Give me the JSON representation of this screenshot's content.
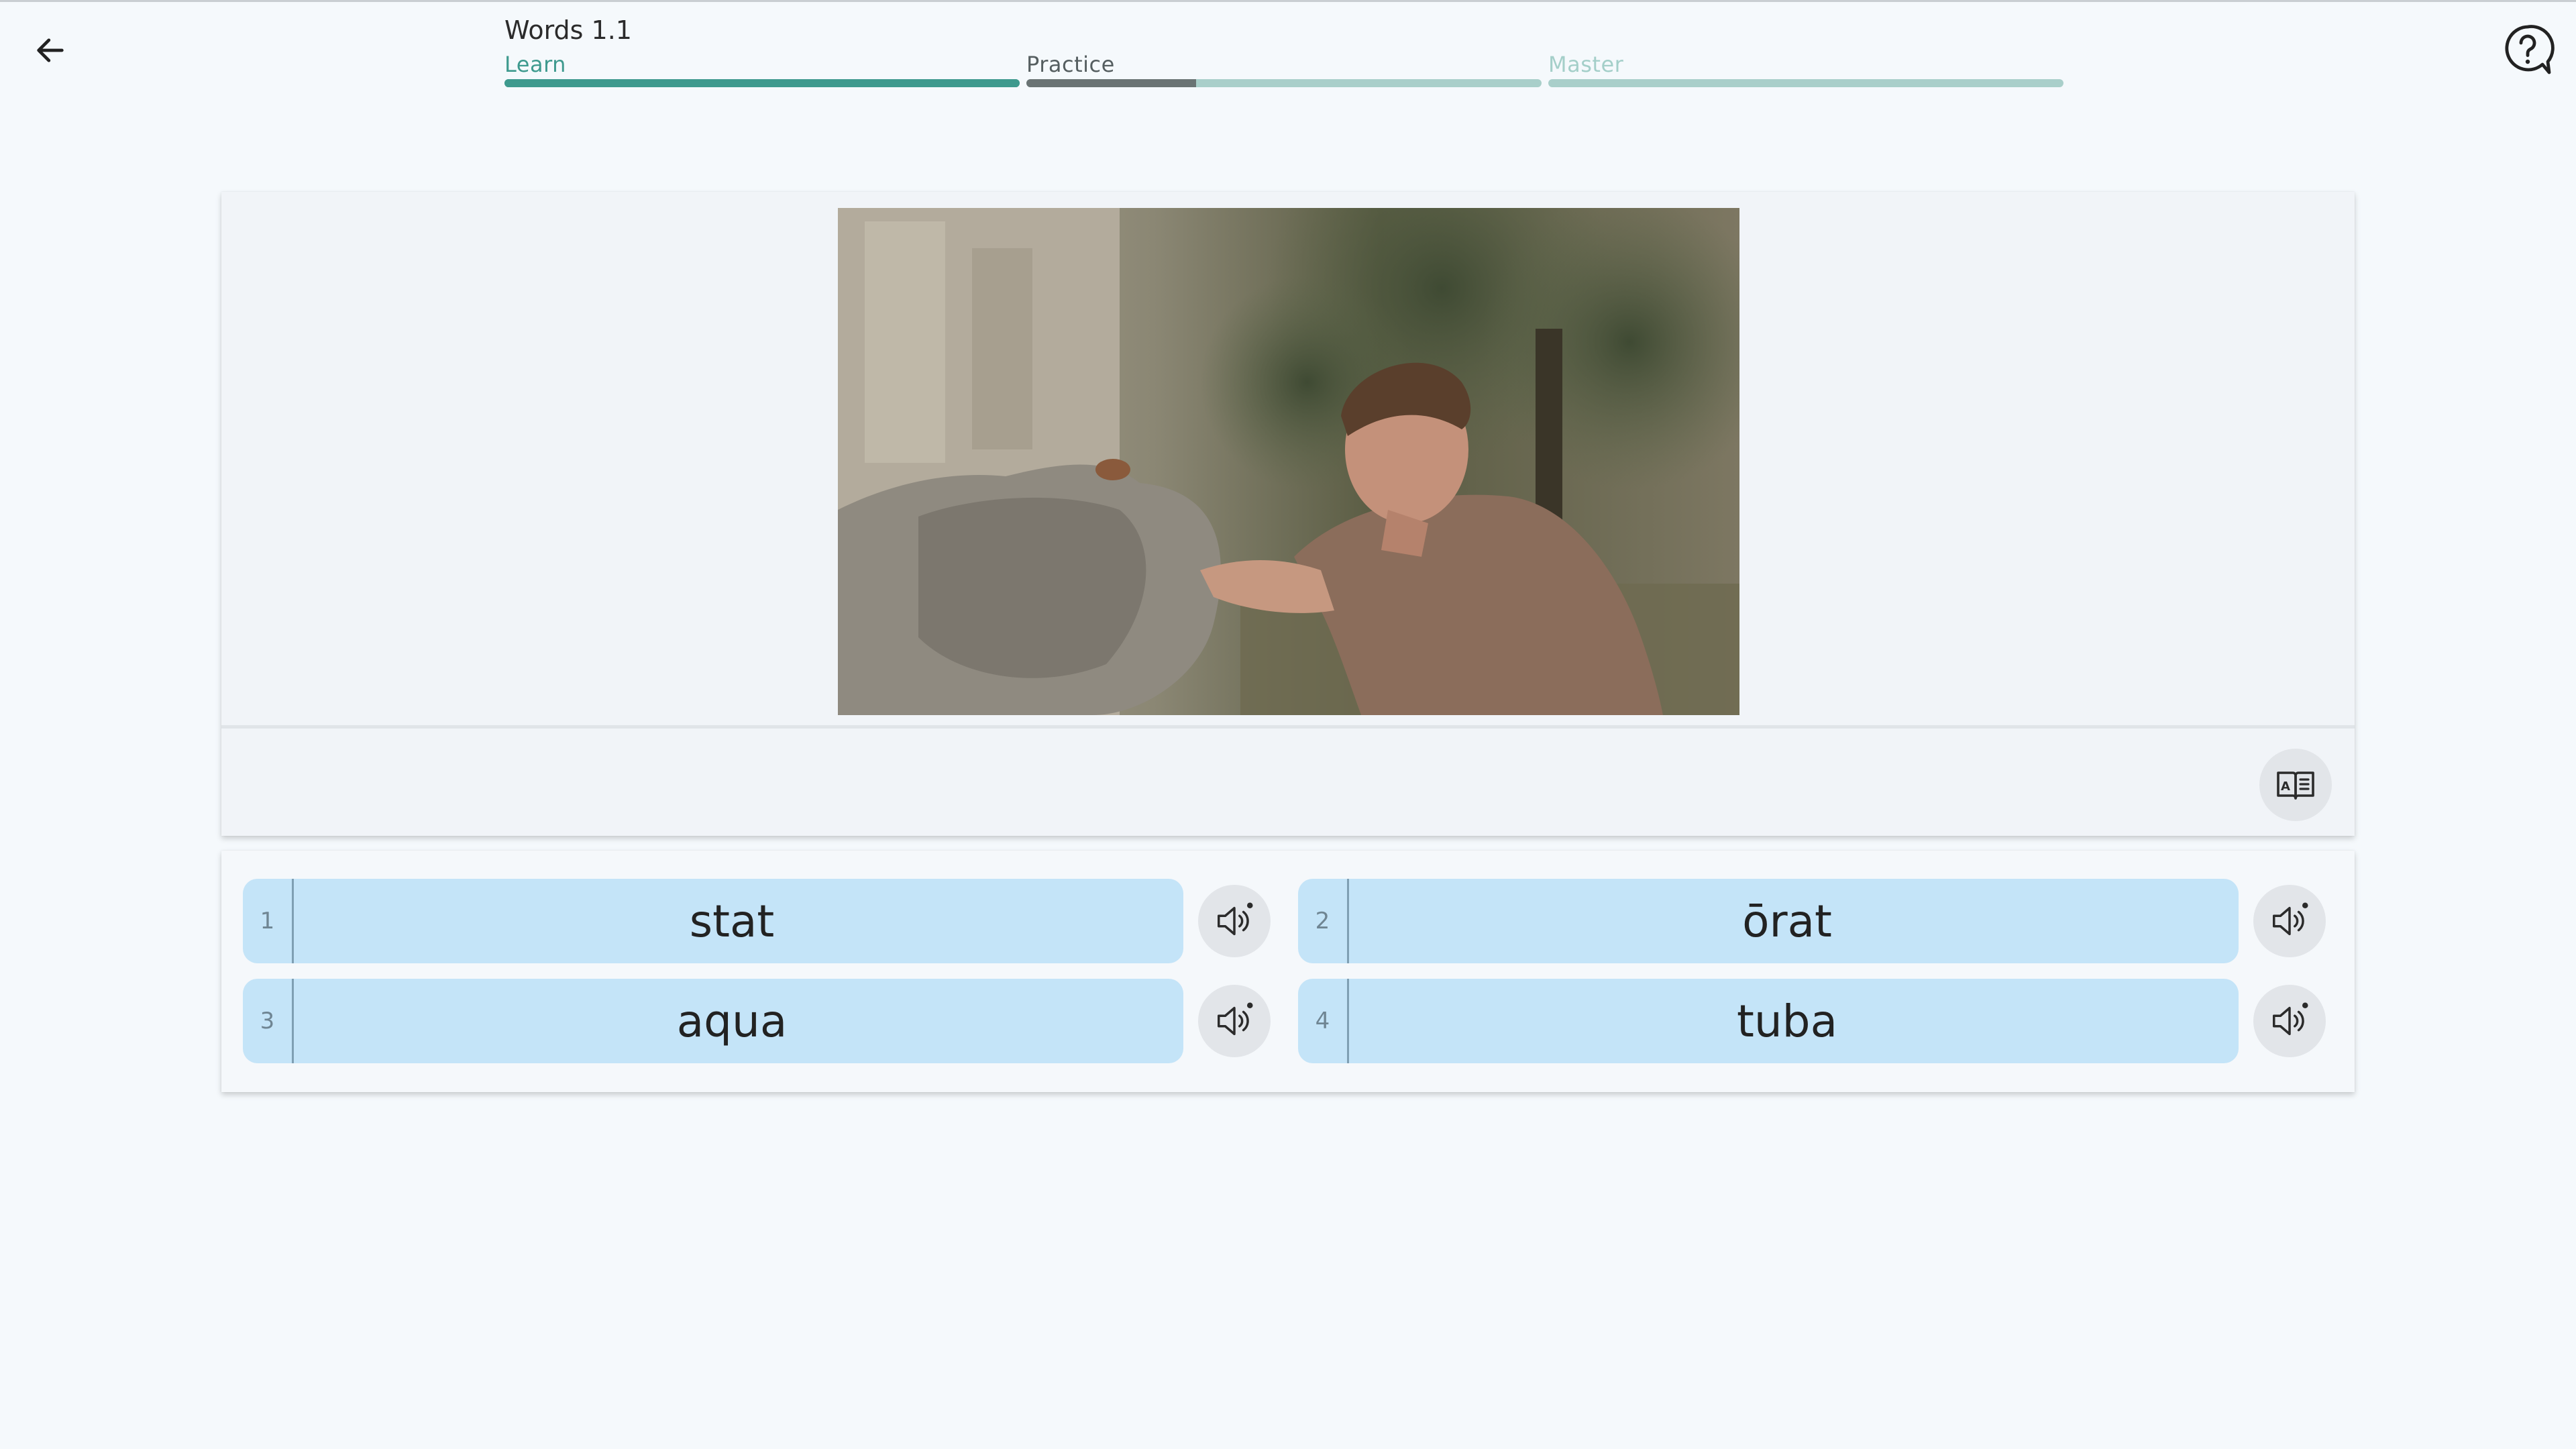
{
  "header": {
    "title": "Words 1.1",
    "stages": [
      {
        "label": "Learn",
        "progress": 1.0,
        "label_color": "#3e9a8e",
        "fill_color": "#3e9a8e",
        "track_color": "#3e9a8e"
      },
      {
        "label": "Practice",
        "progress": 0.33,
        "label_color": "#555e60",
        "fill_color": "#6a7474",
        "track_color": "#a9cfca"
      },
      {
        "label": "Master",
        "progress": 0.0,
        "label_color": "#a4cfc9",
        "fill_color": "#a4cfc9",
        "track_color": "#a9cfca"
      }
    ],
    "back_icon": "arrow-left-icon",
    "help_icon": "question-circle-icon"
  },
  "media": {
    "reference_icon": "book-icon"
  },
  "options": [
    {
      "number": "1",
      "word": "stat",
      "audio_icon": "speaker-icon"
    },
    {
      "number": "2",
      "word": "ōrat",
      "audio_icon": "speaker-icon"
    },
    {
      "number": "3",
      "word": "aqua",
      "audio_icon": "speaker-icon"
    },
    {
      "number": "4",
      "word": "tuba",
      "audio_icon": "speaker-icon"
    }
  ]
}
